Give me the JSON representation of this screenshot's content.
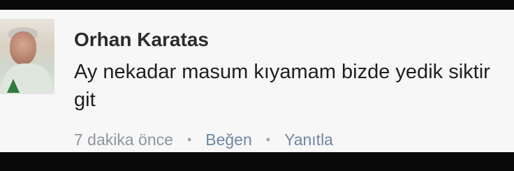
{
  "comment": {
    "author": "Orhan Karatas",
    "text": "Ay nekadar masum kıyamam bizde yedik siktir git",
    "timestamp": "7 dakika önce",
    "separator": "•",
    "actions": {
      "like": "Beğen",
      "reply": "Yanıtla"
    }
  },
  "colors": {
    "card_background": "#f7f7f7",
    "author_text": "#2b2b2b",
    "body_text": "#1f1f1f",
    "meta_text": "#8f959c",
    "action_link": "#6f87a3"
  }
}
